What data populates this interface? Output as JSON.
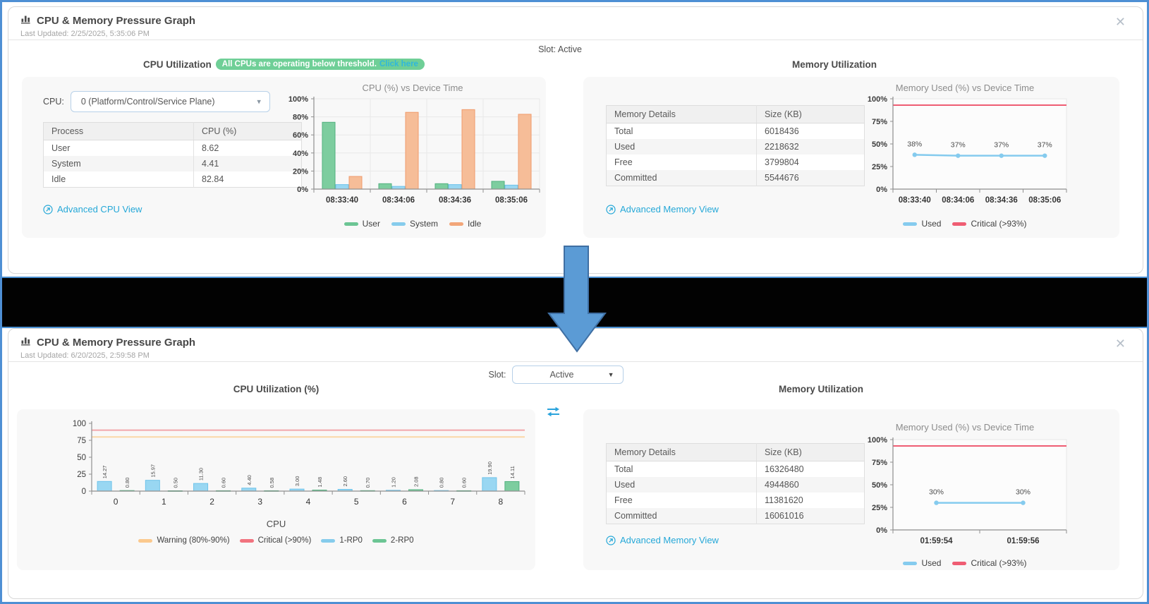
{
  "colors": {
    "accent_blue": "#4a90d2",
    "link_blue": "#25a8d8",
    "badge_green": "#6fcf97",
    "badge_link_blue": "#2fb7dc",
    "user_green": "#6cc594",
    "system_blue": "#86ccec",
    "idle_orange": "#f2a679",
    "used_line_blue": "#85cbee",
    "critical_red": "#ef5d73",
    "warning_orange": "#fbc98e",
    "arrow_blue": "#5b9bd5"
  },
  "top_panel": {
    "title": "CPU & Memory Pressure Graph",
    "last_updated": "Last Updated: 2/25/2025, 5:35:06 PM",
    "close_label": "✕",
    "slot_text": "Slot: Active",
    "cpu_section": {
      "title": "CPU Utilization",
      "badge_text": "All CPUs are operating below threshold.",
      "badge_link": "Click here",
      "cpu_label": "CPU:",
      "cpu_select_value": "0 (Platform/Control/Service Plane)",
      "process_table": {
        "headers": [
          "Process",
          "CPU (%)"
        ],
        "rows": [
          [
            "User",
            "8.62"
          ],
          [
            "System",
            "4.41"
          ],
          [
            "Idle",
            "82.84"
          ]
        ]
      },
      "advanced_link": "Advanced CPU View"
    },
    "memory_section": {
      "title": "Memory Utilization",
      "memory_table": {
        "headers": [
          "Memory Details",
          "Size (KB)"
        ],
        "rows": [
          [
            "Total",
            "6018436"
          ],
          [
            "Used",
            "2218632"
          ],
          [
            "Free",
            "3799804"
          ],
          [
            "Committed",
            "5544676"
          ]
        ]
      },
      "advanced_link": "Advanced Memory View"
    }
  },
  "bottom_panel": {
    "title": "CPU & Memory Pressure Graph",
    "last_updated": "Last Updated: 6/20/2025, 2:59:58 PM",
    "close_label": "✕",
    "slot_label": "Slot:",
    "slot_value": "Active",
    "cpu_chart_title": "CPU Utilization (%)",
    "memory_section": {
      "title": "Memory Utilization",
      "memory_table": {
        "headers": [
          "Memory Details",
          "Size (KB)"
        ],
        "rows": [
          [
            "Total",
            "16326480"
          ],
          [
            "Used",
            "4944860"
          ],
          [
            "Free",
            "11381620"
          ],
          [
            "Committed",
            "16061016"
          ]
        ]
      },
      "advanced_link": "Advanced Memory View"
    }
  },
  "chart_data": [
    {
      "id": "top-cpu",
      "type": "bar",
      "title": "CPU (%) vs Device Time",
      "categories": [
        "08:33:40",
        "08:34:06",
        "08:34:36",
        "08:35:06"
      ],
      "series": [
        {
          "name": "User",
          "color": "#7dcd9f",
          "border": "#52b17f",
          "values": [
            74,
            6,
            6,
            8.62
          ]
        },
        {
          "name": "System",
          "color": "#99d7f2",
          "border": "#6ec3ea",
          "values": [
            5,
            3,
            5,
            4.41
          ]
        },
        {
          "name": "Idle",
          "color": "#f6bd98",
          "border": "#f09a6b",
          "values": [
            14,
            85,
            88,
            82.84
          ]
        }
      ],
      "ylim": [
        0,
        100
      ],
      "yticks": [
        0,
        20,
        40,
        60,
        80,
        100
      ],
      "ysuffix": "%",
      "grid": true,
      "legend_position": "bottom",
      "legend": [
        {
          "label": "User",
          "color": "#6cc594"
        },
        {
          "label": "System",
          "color": "#86ccec"
        },
        {
          "label": "Idle",
          "color": "#f2a679"
        }
      ]
    },
    {
      "id": "top-mem",
      "type": "line",
      "title": "Memory Used (%) vs Device Time",
      "x": [
        "08:33:40",
        "08:34:06",
        "08:34:36",
        "08:35:06"
      ],
      "series": [
        {
          "name": "Used",
          "color": "#85cbee",
          "values": [
            38,
            37,
            37,
            37
          ],
          "labels": [
            "38%",
            "37%",
            "37%",
            "37%"
          ]
        }
      ],
      "thresholds": [
        {
          "name": "Critical (>93%)",
          "value": 93,
          "color": "#ef5d73"
        }
      ],
      "ylim": [
        0,
        100
      ],
      "yticks": [
        0,
        25,
        50,
        75,
        100
      ],
      "ysuffix": "%",
      "legend_position": "bottom",
      "legend": [
        {
          "label": "Used",
          "color": "#85cbee"
        },
        {
          "label": "Critical (>93%)",
          "color": "#ef5d73"
        }
      ]
    },
    {
      "id": "bot-cpu",
      "type": "bar",
      "title": "CPU Utilization (%)",
      "xlabel": "CPU",
      "categories": [
        "0",
        "1",
        "2",
        "3",
        "4",
        "5",
        "6",
        "7",
        "8"
      ],
      "series": [
        {
          "name": "1-RP0",
          "color": "#99d7f2",
          "border": "#6ec3ea",
          "values": [
            14.27,
            15.97,
            11.3,
            4.4,
            3.0,
            2.6,
            1.2,
            0.8,
            19.9
          ],
          "vlabels": [
            "14.27",
            "15.97",
            "11.30",
            "4.40",
            "3.00",
            "2.60",
            "1.20",
            "0.80",
            "19.90"
          ]
        },
        {
          "name": "2-RP0",
          "color": "#7dcd9f",
          "border": "#52b17f",
          "values": [
            0.8,
            0.5,
            0.6,
            0.58,
            1.48,
            0.7,
            2.08,
            0.6,
            14.11
          ],
          "vlabels": [
            "0.80",
            "0.50",
            "0.60",
            "0.58",
            "1.48",
            "0.70",
            "2.08",
            "0.60",
            "14.11"
          ]
        }
      ],
      "value_labels": true,
      "thresholds": [
        {
          "name": "Warning (80%-90%)",
          "value": 80,
          "color": "#fbc98e",
          "line_color": "#fbd7a7"
        },
        {
          "name": "Critical (>90%)",
          "value": 90,
          "color": "#f1737f",
          "line_color": "#f2a6ab"
        }
      ],
      "ylim": [
        0,
        100
      ],
      "yticks": [
        0,
        25,
        50,
        75,
        100
      ],
      "ysuffix": "",
      "legend_position": "bottom",
      "legend": [
        {
          "label": "Warning (80%-90%)",
          "color": "#fbc98e"
        },
        {
          "label": "Critical (>90%)",
          "color": "#f1737f"
        },
        {
          "label": "1-RP0",
          "color": "#86ccec"
        },
        {
          "label": "2-RP0",
          "color": "#6cc594"
        }
      ]
    },
    {
      "id": "bot-mem",
      "type": "line",
      "title": "Memory Used (%) vs Device Time",
      "x": [
        "01:59:54",
        "01:59:56"
      ],
      "series": [
        {
          "name": "Used",
          "color": "#85cbee",
          "values": [
            30,
            30
          ],
          "labels": [
            "30%",
            "30%"
          ]
        }
      ],
      "thresholds": [
        {
          "name": "Critical (>93%)",
          "value": 93,
          "color": "#ef5d73"
        }
      ],
      "ylim": [
        0,
        100
      ],
      "yticks": [
        0,
        25,
        50,
        75,
        100
      ],
      "ysuffix": "%",
      "legend_position": "bottom",
      "legend": [
        {
          "label": "Used",
          "color": "#85cbee"
        },
        {
          "label": "Critical (>93%)",
          "color": "#ef5d73"
        }
      ]
    }
  ]
}
